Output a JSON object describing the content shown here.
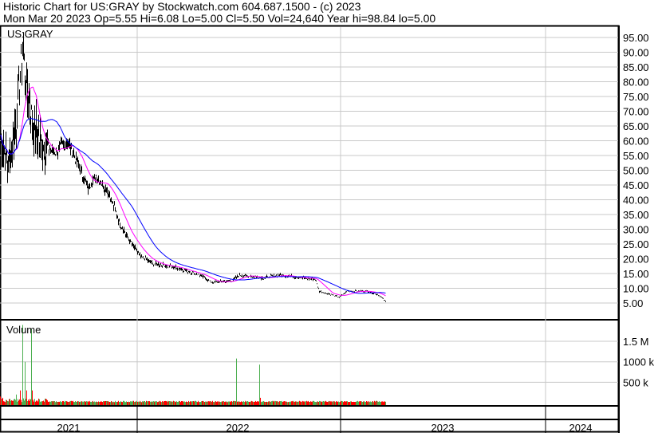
{
  "header": {
    "line1": "Historic Chart for US:GRAY by Stockwatch.com 604.687.1500 - (c) 2023",
    "line2": "Mon Mar 20 2023  Op=5.55  Hi=6.08  Lo=5.00  Cl=5.50  Vol=24,640  Year hi=98.84  lo=5.00"
  },
  "chart_data": [
    {
      "type": "line",
      "title": "US:GRAY",
      "ylim": [
        0,
        98
      ],
      "yticks": [
        5,
        10,
        15,
        20,
        25,
        30,
        35,
        40,
        45,
        50,
        55,
        60,
        65,
        70,
        75,
        80,
        85,
        90,
        95
      ],
      "ytick_labels": [
        "5.00",
        "10.00",
        "15.00",
        "20.00",
        "25.00",
        "30.00",
        "35.00",
        "40.00",
        "45.00",
        "50.00",
        "55.00",
        "60.00",
        "65.00",
        "70.00",
        "75.00",
        "80.00",
        "85.00",
        "90.00",
        "95.00"
      ],
      "x_unit": "trading days from Mar 2021",
      "xlim": [
        0,
        760
      ],
      "price_anchors": [
        [
          0,
          62
        ],
        [
          10,
          51
        ],
        [
          20,
          67
        ],
        [
          28,
          91
        ],
        [
          35,
          75
        ],
        [
          40,
          67
        ],
        [
          50,
          59
        ],
        [
          70,
          56
        ],
        [
          85,
          60
        ],
        [
          100,
          50
        ],
        [
          110,
          44
        ],
        [
          120,
          48
        ],
        [
          135,
          43
        ],
        [
          150,
          32
        ],
        [
          160,
          27
        ],
        [
          175,
          21
        ],
        [
          190,
          18.5
        ],
        [
          220,
          17
        ],
        [
          250,
          14.5
        ],
        [
          265,
          12
        ],
        [
          290,
          12.5
        ],
        [
          300,
          14.5
        ],
        [
          330,
          13.5
        ],
        [
          350,
          14.5
        ],
        [
          395,
          13
        ],
        [
          400,
          9
        ],
        [
          425,
          7
        ],
        [
          435,
          9
        ],
        [
          460,
          9
        ],
        [
          475,
          7.7
        ],
        [
          483,
          5.5
        ]
      ],
      "series": [
        {
          "name": "Price",
          "color": "#000000"
        },
        {
          "name": "MA short",
          "color": "#ff00ff"
        },
        {
          "name": "MA long",
          "color": "#0000ff"
        }
      ],
      "x_categories": [
        "2021",
        "2022",
        "2023",
        "2024"
      ]
    },
    {
      "type": "bar",
      "title": "Volume",
      "ylim": [
        0,
        2000000
      ],
      "yticks": [
        500000,
        1000000,
        1500000
      ],
      "ytick_labels": [
        "500 k",
        "1000 k",
        "1.5 M"
      ],
      "baseline_volume": 30000,
      "spikes": [
        [
          0,
          150000,
          "down"
        ],
        [
          3,
          120000,
          "down"
        ],
        [
          20,
          200000,
          "green"
        ],
        [
          25,
          300000,
          "down"
        ],
        [
          28,
          1900000,
          "green"
        ],
        [
          31,
          1000000,
          "green"
        ],
        [
          33,
          300000,
          "down"
        ],
        [
          39,
          1800000,
          "green"
        ],
        [
          40,
          300000,
          "down"
        ],
        [
          296,
          1080000,
          "green"
        ],
        [
          325,
          930000,
          "green"
        ],
        [
          326,
          120000,
          "down"
        ]
      ],
      "colors": {
        "up": "#4caf50",
        "down": "#ff0000"
      }
    }
  ]
}
